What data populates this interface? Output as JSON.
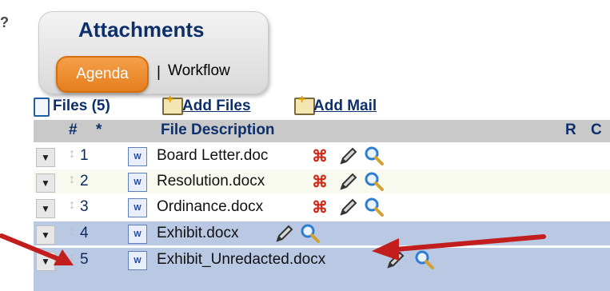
{
  "header": {
    "title": "Attachments",
    "tabs": [
      {
        "label": "Agenda",
        "active": true
      },
      {
        "label": "Workflow",
        "active": false
      }
    ],
    "separator": "|"
  },
  "files_bar": {
    "files_label": "Files (5)",
    "add_files_label": "Add Files",
    "add_mail_label": "Add Mail"
  },
  "table": {
    "headers": {
      "num": "#",
      "star": "*",
      "description": "File Description",
      "r": "R",
      "c": "C"
    },
    "rows": [
      {
        "num": "1",
        "name": "Board Letter.doc"
      },
      {
        "num": "2",
        "name": "Resolution.docx"
      },
      {
        "num": "3",
        "name": "Ordinance.docx"
      },
      {
        "num": "4",
        "name": "Exhibit.docx"
      },
      {
        "num": "5",
        "name": "Exhibit_Unredacted.docx"
      }
    ]
  },
  "colors": {
    "brand_navy": "#0d2f6b",
    "tab_orange": "#e57e1d",
    "selected_row": "#b9c8e3",
    "arrow_red": "#c21e1e"
  }
}
